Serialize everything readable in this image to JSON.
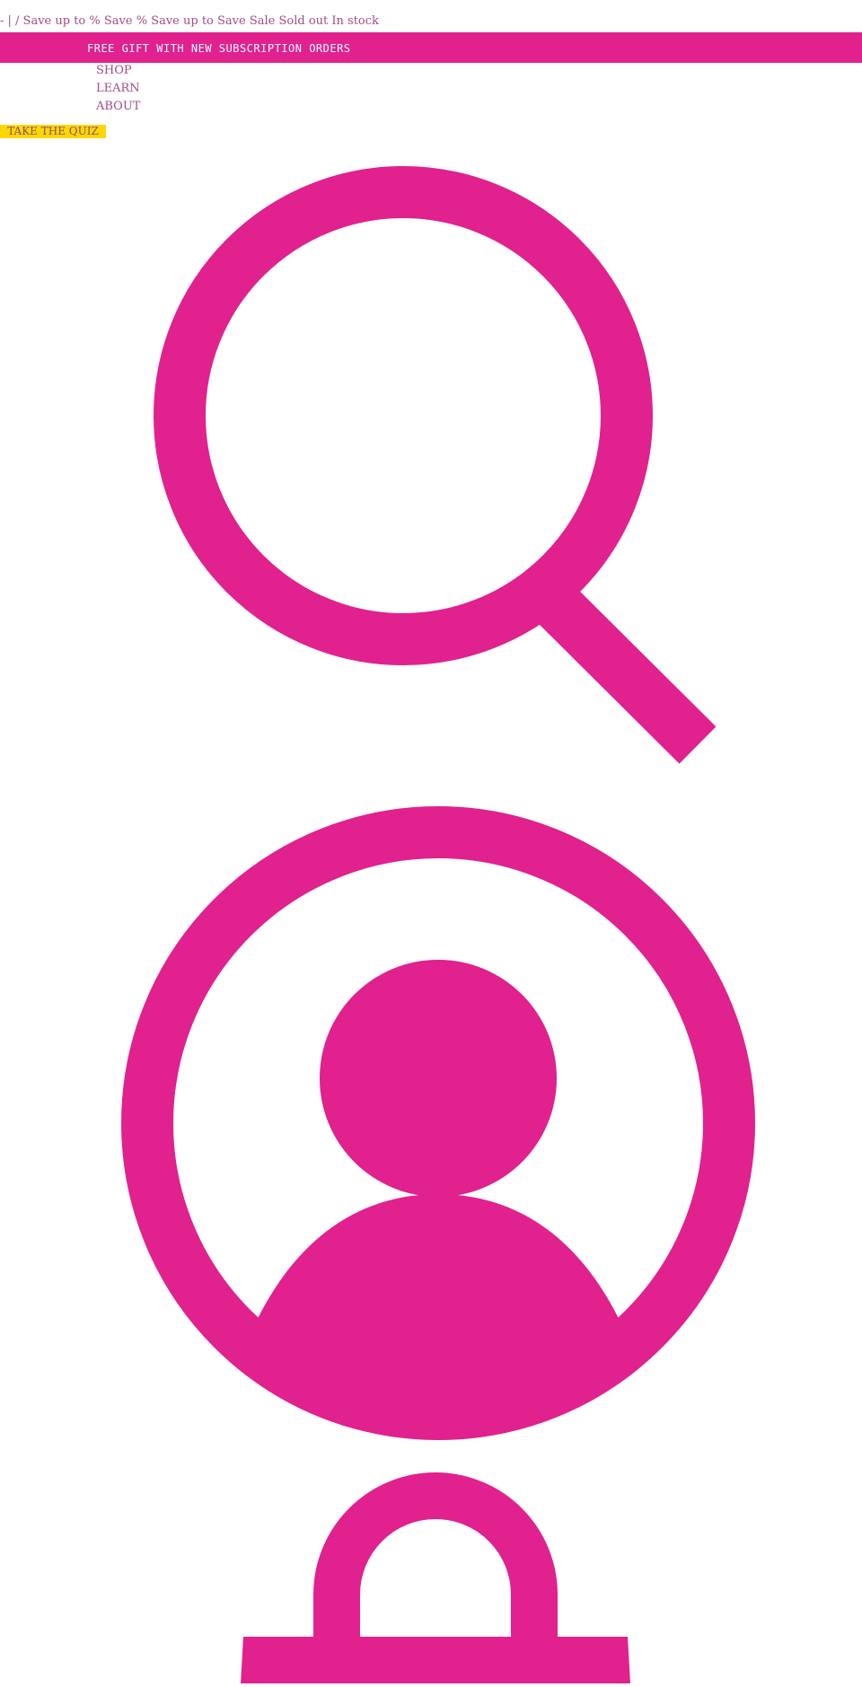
{
  "price_strings": "- | / Save up to % Save % Save up to Save Sale Sold out In stock",
  "announcement": {
    "text": "FREE GIFT WITH NEW SUBSCRIPTION ORDERS"
  },
  "nav": {
    "items": [
      {
        "label": "SHOP"
      },
      {
        "label": "LEARN"
      },
      {
        "label": "ABOUT"
      }
    ]
  },
  "quiz_button": {
    "label": "TAKE THE QUIZ"
  },
  "header_icons": [
    "search-icon",
    "account-icon",
    "cart-icon"
  ],
  "colors": {
    "brand_pink": "#e0218e",
    "quiz_yellow": "#ffd700",
    "text_mauve": "#a54b86"
  }
}
